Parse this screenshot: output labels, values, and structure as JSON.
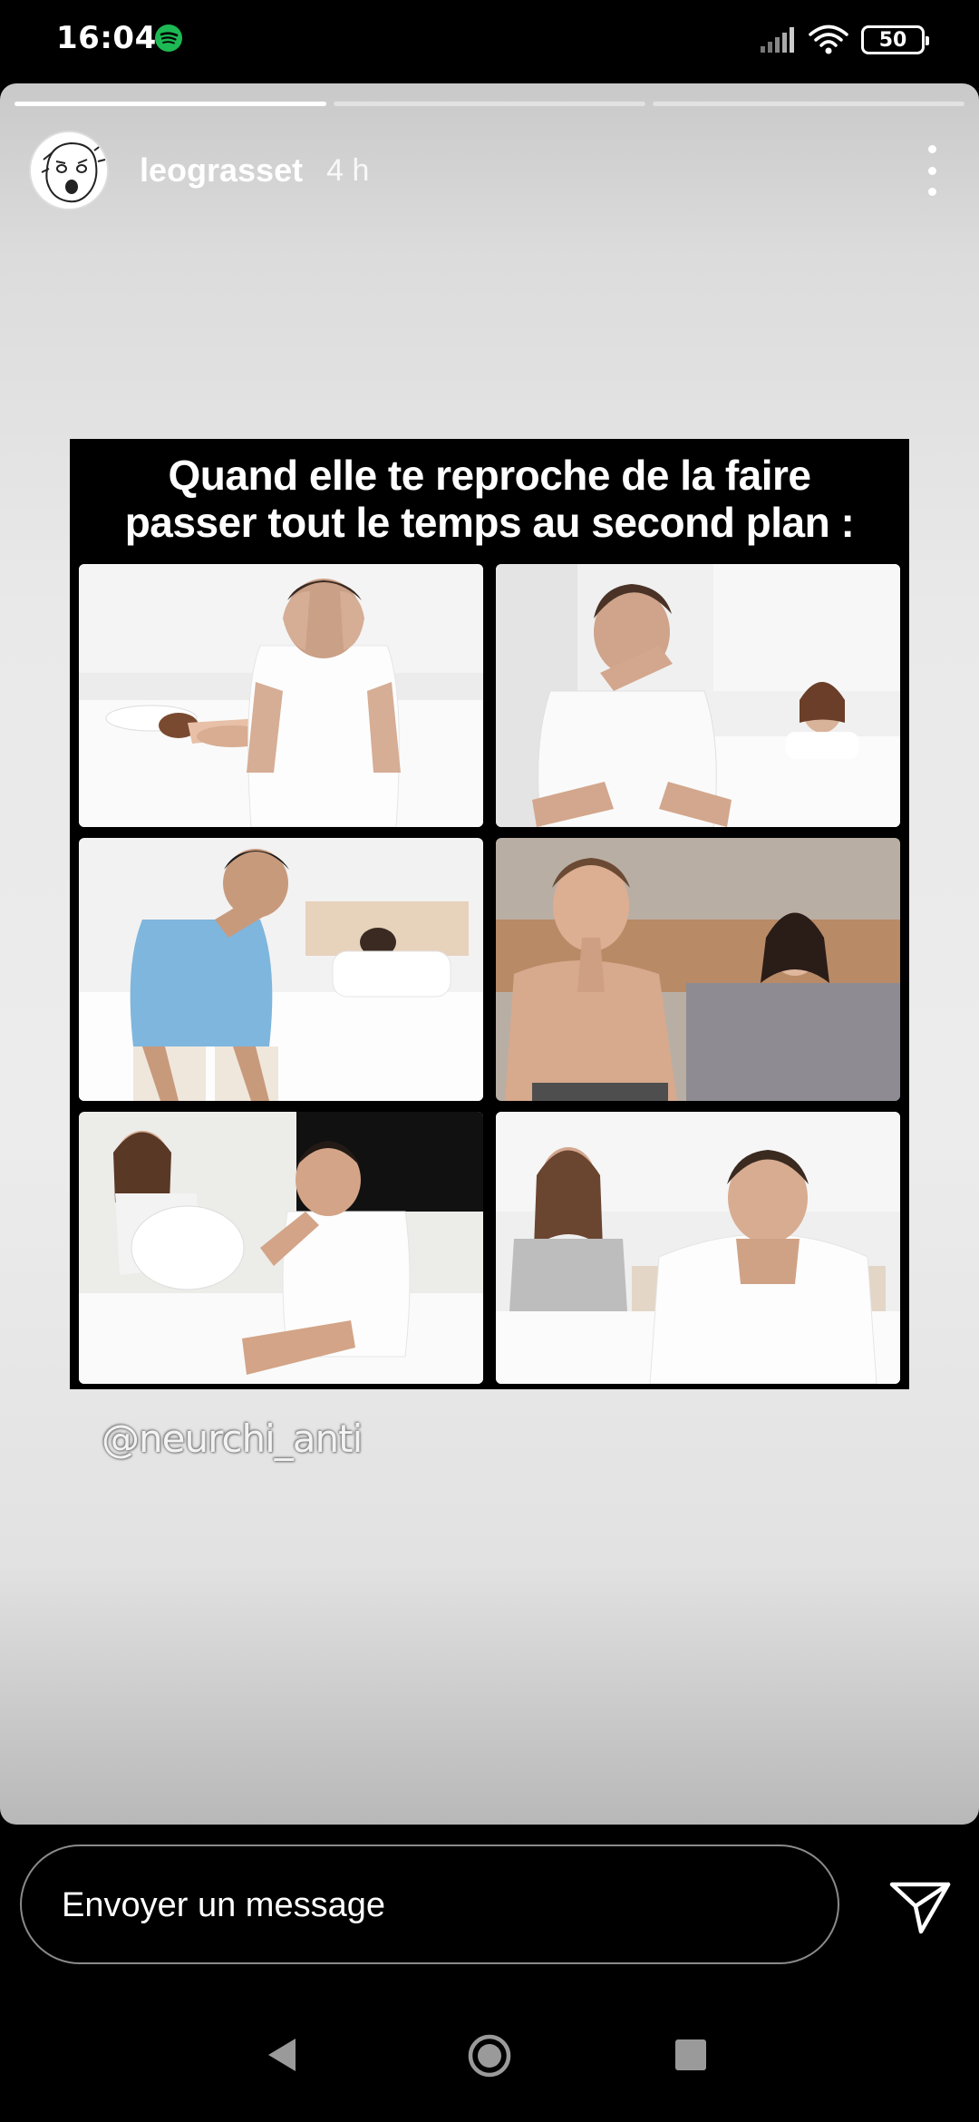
{
  "status_bar": {
    "time": "16:04",
    "battery": "50",
    "icons": [
      "spotify-icon",
      "signal-icon",
      "wifi-icon",
      "battery-icon"
    ],
    "spotify_color": "#1DB954"
  },
  "story": {
    "progress": [
      1.0,
      0.0,
      0.0
    ],
    "username": "leograsset",
    "timestamp": "4 h",
    "meme": {
      "caption_line1": "Quand elle te reproche de la faire",
      "caption_line2": "passer tout le temps au second plan :"
    },
    "mention": "@neurchi_anti"
  },
  "reply": {
    "placeholder": "Envoyer un message"
  },
  "colors": {
    "background": "#000000",
    "story_gradient_top": "#c9c9c9",
    "story_gradient_mid": "#ececec",
    "input_border": "#8a8a8a"
  }
}
